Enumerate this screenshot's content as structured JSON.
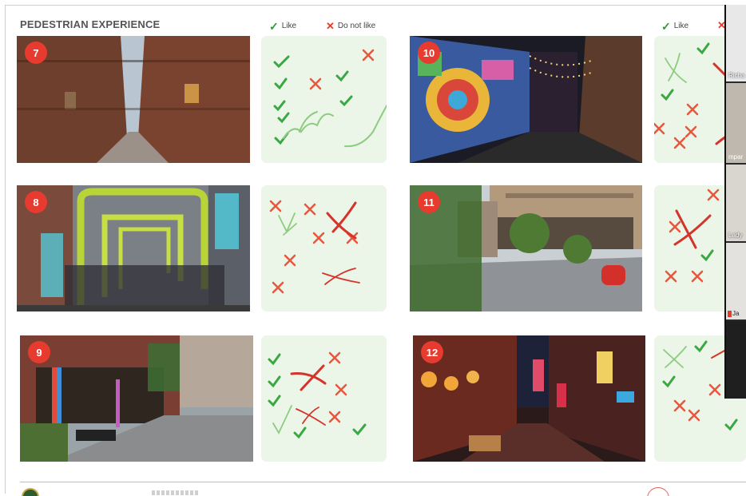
{
  "slide": {
    "title": "PEDESTRIAN EXPERIENCE",
    "legend": {
      "like": "Like",
      "dislike": "Do not like",
      "like_right": "Like"
    }
  },
  "photos": [
    {
      "number": "7"
    },
    {
      "number": "8"
    },
    {
      "number": "9"
    },
    {
      "number": "10"
    },
    {
      "number": "11"
    },
    {
      "number": "12"
    }
  ],
  "zoom": {
    "participants": [
      {
        "name": "Richa"
      },
      {
        "name": "mpar"
      },
      {
        "name": "Lady"
      },
      {
        "name": "Ja"
      }
    ]
  },
  "colors": {
    "like": "#2e9a3a",
    "dislike": "#e33c2c",
    "badge": "#e63b2e",
    "panel": "#ebf5e8"
  }
}
